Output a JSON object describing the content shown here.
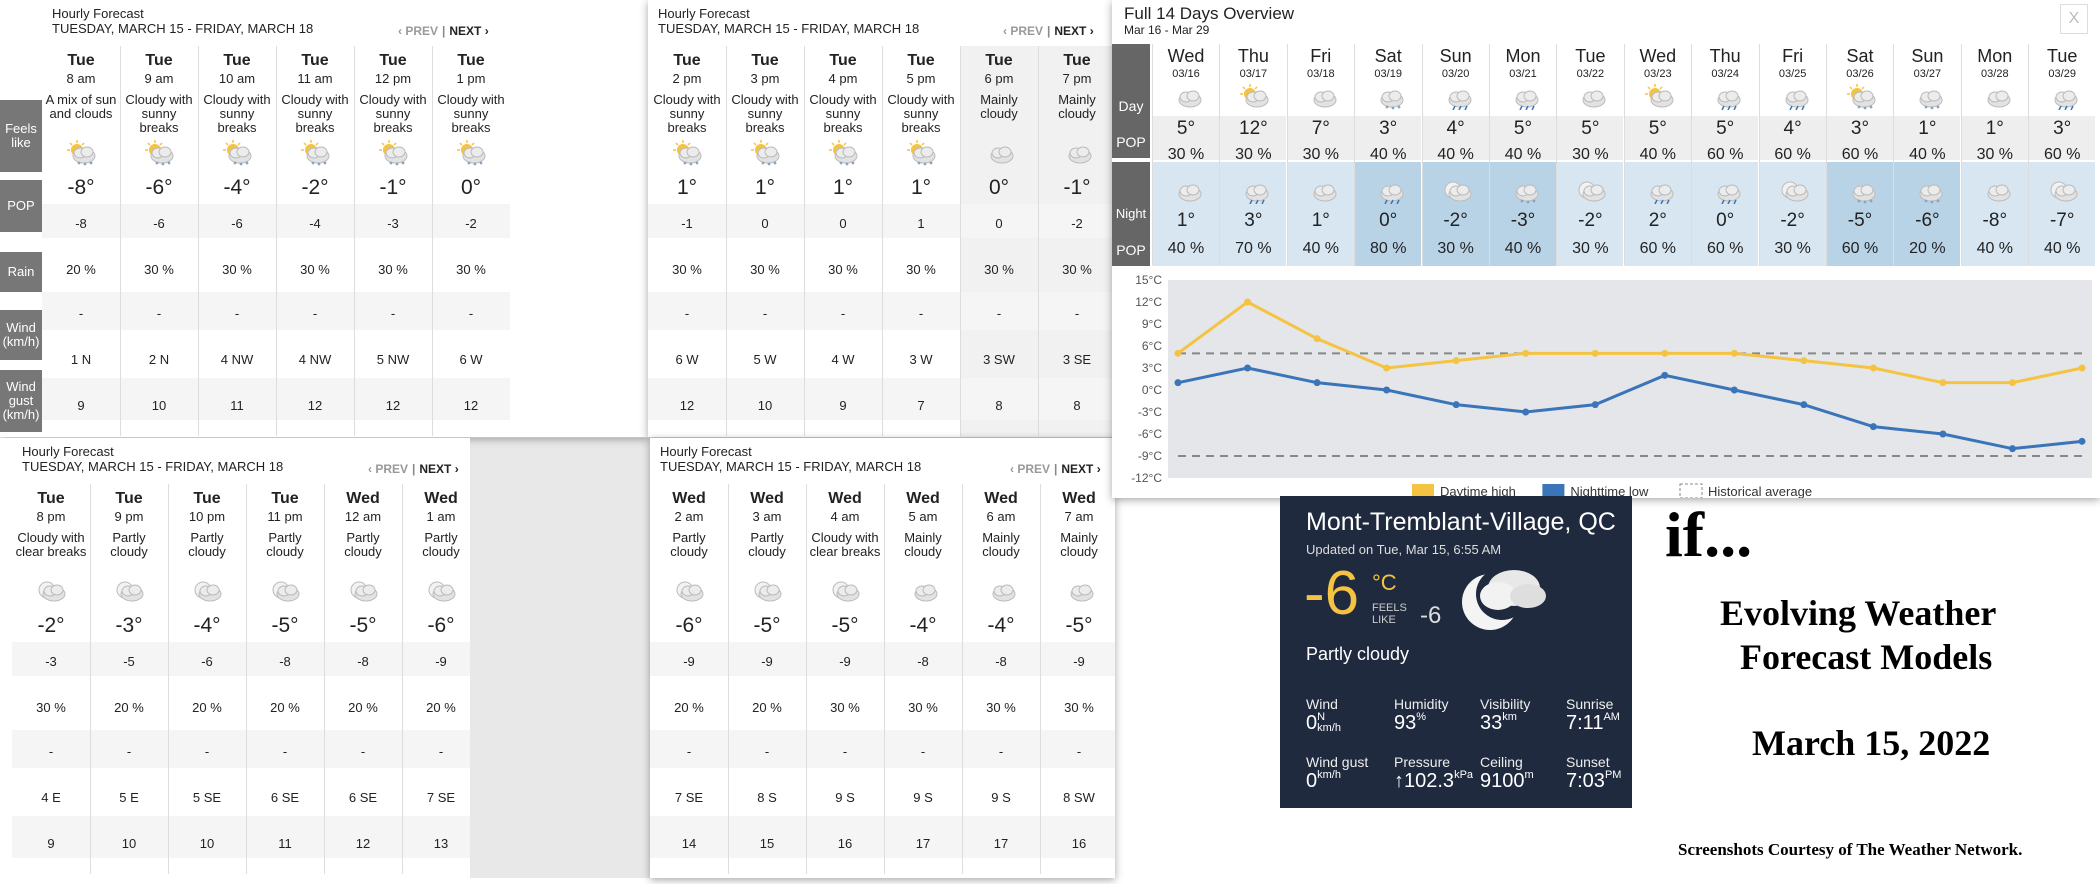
{
  "hourly_panels": [
    {
      "title": "Hourly Forecast",
      "subtitle": "TUESDAY, MARCH 15 - FRIDAY, MARCH 18",
      "prev": "‹ PREV",
      "sep": "|",
      "next": "NEXT ›",
      "labels": {
        "feels": "Feels like",
        "pop": "POP",
        "rain": "Rain",
        "wind": "Wind (km/h)",
        "gust": "Wind gust (km/h)"
      },
      "hours": [
        {
          "day": "Tue",
          "time": "8 am",
          "cond": "A mix of sun and clouds",
          "icon": "sun-cloud-snow-icon",
          "temp": "-8°",
          "feels": "-8",
          "pop": "20 %",
          "rain": "-",
          "wind": "1 N",
          "gust": "9"
        },
        {
          "day": "Tue",
          "time": "9 am",
          "cond": "Cloudy with sunny breaks",
          "icon": "sun-cloud-snow-icon",
          "temp": "-6°",
          "feels": "-6",
          "pop": "30 %",
          "rain": "-",
          "wind": "2 N",
          "gust": "10"
        },
        {
          "day": "Tue",
          "time": "10 am",
          "cond": "Cloudy with sunny breaks",
          "icon": "sun-cloud-snow-icon",
          "temp": "-4°",
          "feels": "-6",
          "pop": "30 %",
          "rain": "-",
          "wind": "4 NW",
          "gust": "11"
        },
        {
          "day": "Tue",
          "time": "11 am",
          "cond": "Cloudy with sunny breaks",
          "icon": "sun-cloud-snow-icon",
          "temp": "-2°",
          "feels": "-4",
          "pop": "30 %",
          "rain": "-",
          "wind": "4 NW",
          "gust": "12"
        },
        {
          "day": "Tue",
          "time": "12 pm",
          "cond": "Cloudy with sunny breaks",
          "icon": "sun-cloud-snow-icon",
          "temp": "-1°",
          "feels": "-3",
          "pop": "30 %",
          "rain": "-",
          "wind": "5 NW",
          "gust": "12"
        },
        {
          "day": "Tue",
          "time": "1 pm",
          "cond": "Cloudy with sunny breaks",
          "icon": "sun-cloud-snow-icon",
          "temp": "0°",
          "feels": "-2",
          "pop": "30 %",
          "rain": "-",
          "wind": "6 W",
          "gust": "12"
        }
      ]
    },
    {
      "title": "Hourly Forecast",
      "subtitle": "TUESDAY, MARCH 15 - FRIDAY, MARCH 18",
      "prev": "‹ PREV",
      "sep": "|",
      "next": "NEXT ›",
      "hours": [
        {
          "day": "Tue",
          "time": "2 pm",
          "cond": "Cloudy with sunny breaks",
          "icon": "sun-cloud-snow-icon",
          "temp": "1°",
          "feels": "-1",
          "pop": "30 %",
          "rain": "-",
          "wind": "6 W",
          "gust": "12"
        },
        {
          "day": "Tue",
          "time": "3 pm",
          "cond": "Cloudy with sunny breaks",
          "icon": "sun-cloud-snow-icon",
          "temp": "1°",
          "feels": "0",
          "pop": "30 %",
          "rain": "-",
          "wind": "5 W",
          "gust": "10"
        },
        {
          "day": "Tue",
          "time": "4 pm",
          "cond": "Cloudy with sunny breaks",
          "icon": "sun-cloud-snow-icon",
          "temp": "1°",
          "feels": "0",
          "pop": "30 %",
          "rain": "-",
          "wind": "4 W",
          "gust": "9"
        },
        {
          "day": "Tue",
          "time": "5 pm",
          "cond": "Cloudy with sunny breaks",
          "icon": "sun-cloud-snow-icon",
          "temp": "1°",
          "feels": "1",
          "pop": "30 %",
          "rain": "-",
          "wind": "3 W",
          "gust": "7"
        },
        {
          "day": "Tue",
          "time": "6 pm",
          "cond": "Mainly cloudy",
          "icon": "cloud-icon",
          "temp": "0°",
          "feels": "0",
          "pop": "30 %",
          "rain": "-",
          "wind": "3 SW",
          "gust": "8"
        },
        {
          "day": "Tue",
          "time": "7 pm",
          "cond": "Mainly cloudy",
          "icon": "cloud-icon",
          "temp": "-1°",
          "feels": "-2",
          "pop": "30 %",
          "rain": "-",
          "wind": "3 SE",
          "gust": "8"
        }
      ]
    },
    {
      "title": "Hourly Forecast",
      "subtitle": "TUESDAY, MARCH 15 - FRIDAY, MARCH 18",
      "prev": "‹ PREV",
      "sep": "|",
      "next": "NEXT ›",
      "hours": [
        {
          "day": "Tue",
          "time": "8 pm",
          "cond": "Cloudy with clear breaks",
          "icon": "moon-cloud-icon",
          "temp": "-2°",
          "feels": "-3",
          "pop": "30 %",
          "rain": "-",
          "wind": "4 E",
          "gust": "9"
        },
        {
          "day": "Tue",
          "time": "9 pm",
          "cond": "Partly cloudy",
          "icon": "moon-cloud-icon",
          "temp": "-3°",
          "feels": "-5",
          "pop": "20 %",
          "rain": "-",
          "wind": "5 E",
          "gust": "10"
        },
        {
          "day": "Tue",
          "time": "10 pm",
          "cond": "Partly cloudy",
          "icon": "moon-cloud-icon",
          "temp": "-4°",
          "feels": "-6",
          "pop": "20 %",
          "rain": "-",
          "wind": "5 SE",
          "gust": "10"
        },
        {
          "day": "Tue",
          "time": "11 pm",
          "cond": "Partly cloudy",
          "icon": "moon-cloud-icon",
          "temp": "-5°",
          "feels": "-8",
          "pop": "20 %",
          "rain": "-",
          "wind": "6 SE",
          "gust": "11"
        },
        {
          "day": "Wed",
          "time": "12 am",
          "cond": "Partly cloudy",
          "icon": "moon-cloud-icon",
          "temp": "-5°",
          "feels": "-8",
          "pop": "20 %",
          "rain": "-",
          "wind": "6 SE",
          "gust": "12"
        },
        {
          "day": "Wed",
          "time": "1 am",
          "cond": "Partly cloudy",
          "icon": "moon-cloud-icon",
          "temp": "-6°",
          "feels": "-9",
          "pop": "20 %",
          "rain": "-",
          "wind": "7 SE",
          "gust": "13"
        }
      ]
    },
    {
      "title": "Hourly Forecast",
      "subtitle": "TUESDAY, MARCH 15 - FRIDAY, MARCH 18",
      "prev": "‹ PREV",
      "sep": "|",
      "next": "NEXT ›",
      "hours": [
        {
          "day": "Wed",
          "time": "2 am",
          "cond": "Partly cloudy",
          "icon": "moon-cloud-icon",
          "temp": "-6°",
          "feels": "-9",
          "pop": "20 %",
          "rain": "-",
          "wind": "7 SE",
          "gust": "14"
        },
        {
          "day": "Wed",
          "time": "3 am",
          "cond": "Partly cloudy",
          "icon": "moon-cloud-icon",
          "temp": "-5°",
          "feels": "-9",
          "pop": "20 %",
          "rain": "-",
          "wind": "8 S",
          "gust": "15"
        },
        {
          "day": "Wed",
          "time": "4 am",
          "cond": "Cloudy with clear breaks",
          "icon": "moon-cloud-icon",
          "temp": "-5°",
          "feels": "-9",
          "pop": "30 %",
          "rain": "-",
          "wind": "9 S",
          "gust": "16"
        },
        {
          "day": "Wed",
          "time": "5 am",
          "cond": "Mainly cloudy",
          "icon": "cloud-icon",
          "temp": "-4°",
          "feels": "-8",
          "pop": "30 %",
          "rain": "-",
          "wind": "9 S",
          "gust": "17"
        },
        {
          "day": "Wed",
          "time": "6 am",
          "cond": "Mainly cloudy",
          "icon": "cloud-icon",
          "temp": "-4°",
          "feels": "-8",
          "pop": "30 %",
          "rain": "-",
          "wind": "9 S",
          "gust": "17"
        },
        {
          "day": "Wed",
          "time": "7 am",
          "cond": "Mainly cloudy",
          "icon": "cloud-icon",
          "temp": "-5°",
          "feels": "-9",
          "pop": "30 %",
          "rain": "-",
          "wind": "8 SW",
          "gust": "16"
        }
      ]
    }
  ],
  "overview": {
    "title": "Full 14 Days Overview",
    "range": "Mar 16 - Mar 29",
    "close": "X",
    "labels": {
      "day": "Day",
      "pop": "POP",
      "night": "Night",
      "npop": "POP"
    },
    "days": [
      {
        "dow": "Wed",
        "date": "03/16",
        "d_icon": "cloud-icon",
        "high": "5°",
        "dpop": "30 %",
        "n_icon": "cloud-icon",
        "low": "1°",
        "npop": "40 %"
      },
      {
        "dow": "Thu",
        "date": "03/17",
        "d_icon": "sun-cloud-icon",
        "high": "12°",
        "dpop": "30 %",
        "n_icon": "cloud-rain-icon",
        "low": "3°",
        "npop": "70 %"
      },
      {
        "dow": "Fri",
        "date": "03/18",
        "d_icon": "cloud-icon",
        "high": "7°",
        "dpop": "30 %",
        "n_icon": "cloud-icon",
        "low": "1°",
        "npop": "40 %"
      },
      {
        "dow": "Sat",
        "date": "03/19",
        "d_icon": "cloud-snow-icon",
        "high": "3°",
        "dpop": "40 %",
        "n_icon": "cloud-rain-icon",
        "low": "0°",
        "npop": "80 %"
      },
      {
        "dow": "Sun",
        "date": "03/20",
        "d_icon": "cloud-rain-icon",
        "high": "4°",
        "dpop": "40 %",
        "n_icon": "moon-cloud-icon",
        "low": "-2°",
        "npop": "30 %"
      },
      {
        "dow": "Mon",
        "date": "03/21",
        "d_icon": "cloud-rain-icon",
        "high": "5°",
        "dpop": "40 %",
        "n_icon": "cloud-snow-icon",
        "low": "-3°",
        "npop": "40 %"
      },
      {
        "dow": "Tue",
        "date": "03/22",
        "d_icon": "cloud-icon",
        "high": "5°",
        "dpop": "30 %",
        "n_icon": "moon-cloud-icon",
        "low": "-2°",
        "npop": "30 %"
      },
      {
        "dow": "Wed",
        "date": "03/23",
        "d_icon": "sun-cloud-icon",
        "high": "5°",
        "dpop": "40 %",
        "n_icon": "cloud-rain-icon",
        "low": "2°",
        "npop": "60 %"
      },
      {
        "dow": "Thu",
        "date": "03/24",
        "d_icon": "cloud-rain-icon",
        "high": "5°",
        "dpop": "60 %",
        "n_icon": "cloud-rain-icon",
        "low": "0°",
        "npop": "60 %"
      },
      {
        "dow": "Fri",
        "date": "03/25",
        "d_icon": "cloud-rain-icon",
        "high": "4°",
        "dpop": "60 %",
        "n_icon": "moon-cloud-icon",
        "low": "-2°",
        "npop": "30 %"
      },
      {
        "dow": "Sat",
        "date": "03/26",
        "d_icon": "sun-cloud-snow-icon",
        "high": "3°",
        "dpop": "60 %",
        "n_icon": "cloud-snow-icon",
        "low": "-5°",
        "npop": "60 %"
      },
      {
        "dow": "Sun",
        "date": "03/27",
        "d_icon": "cloud-snow-icon",
        "high": "1°",
        "dpop": "40 %",
        "n_icon": "cloud-snow-icon",
        "low": "-6°",
        "npop": "20 %"
      },
      {
        "dow": "Mon",
        "date": "03/28",
        "d_icon": "cloud-icon",
        "high": "1°",
        "dpop": "30 %",
        "n_icon": "cloud-icon",
        "low": "-8°",
        "npop": "40 %"
      },
      {
        "dow": "Tue",
        "date": "03/29",
        "d_icon": "cloud-rain-icon",
        "high": "3°",
        "dpop": "60 %",
        "n_icon": "moon-cloud-icon",
        "low": "-7°",
        "npop": "40 %"
      }
    ]
  },
  "chart_data": {
    "type": "line",
    "x": [
      "03/16",
      "03/17",
      "03/18",
      "03/19",
      "03/20",
      "03/21",
      "03/22",
      "03/23",
      "03/24",
      "03/25",
      "03/26",
      "03/27",
      "03/28",
      "03/29"
    ],
    "series": [
      {
        "name": "Daytime high",
        "color": "#f5c342",
        "values": [
          5,
          12,
          7,
          3,
          4,
          5,
          5,
          5,
          5,
          4,
          3,
          1,
          1,
          3
        ]
      },
      {
        "name": "Nighttime low",
        "color": "#3a74b9",
        "values": [
          1,
          3,
          1,
          0,
          -2,
          -3,
          -2,
          2,
          0,
          -2,
          -5,
          -6,
          -8,
          -7
        ]
      },
      {
        "name": "Historical average",
        "color": "#999999",
        "style": "dashed",
        "values": [
          5,
          5,
          5,
          5,
          5,
          5,
          5,
          5,
          5,
          5,
          5,
          5,
          5,
          5
        ],
        "values_low": [
          -9,
          -9,
          -9,
          -9,
          -9,
          -9,
          -9,
          -9,
          -9,
          -9,
          -9,
          -9,
          -9,
          -9
        ]
      }
    ],
    "ylim": [
      -12,
      15
    ],
    "yticks": [
      "15°C",
      "12°C",
      "9°C",
      "6°C",
      "3°C",
      "0°C",
      "-3°C",
      "-6°C",
      "-9°C",
      "-12°C"
    ],
    "legend_position": "bottom"
  },
  "current": {
    "location": "Mont-Tremblant-Village, QC",
    "updated": "Updated on Tue, Mar 15, 6:55 AM",
    "temp": "-6",
    "unit": "°C",
    "feels_label": "FEELS LIKE",
    "feels": "-6",
    "condition": "Partly cloudy",
    "icon": "moon-cloud-icon",
    "stats": [
      {
        "label": "Wind",
        "value": "0",
        "sup": "N",
        "sub": "km/h"
      },
      {
        "label": "Humidity",
        "value": "93",
        "sup": "%",
        "sub": ""
      },
      {
        "label": "Visibility",
        "value": "33",
        "sup": "km",
        "sub": ""
      },
      {
        "label": "Sunrise",
        "value": "7:11",
        "sup": "AM",
        "sub": ""
      },
      {
        "label": "Wind gust",
        "value": "0",
        "sup": "",
        "sub": "km/h"
      },
      {
        "label": "Pressure",
        "value": "↑102.3",
        "sup": "kPa",
        "sub": ""
      },
      {
        "label": "Ceiling",
        "value": "9100",
        "sup": "m",
        "sub": ""
      },
      {
        "label": "Sunset",
        "value": "7:03",
        "sup": "PM",
        "sub": ""
      }
    ]
  },
  "slide": {
    "if": "if...",
    "line1": "Evolving Weather",
    "line2": "Forecast Models",
    "date": "March 15, 2022",
    "credit": "Screenshots Courtesy of The Weather Network."
  },
  "colors": {
    "label_bg": "#777777",
    "blue_strip": "#2a6cbf",
    "night_bg": "#c7dceb",
    "current_bg": "#1f2a3f"
  }
}
